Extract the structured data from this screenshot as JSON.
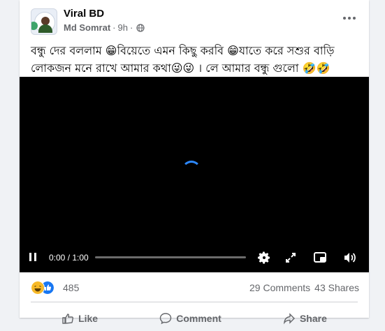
{
  "post": {
    "page_name": "Viral BD",
    "author": "Md Somrat",
    "separator": "·",
    "time": "9h",
    "caption_line1": "বন্ধু দের বললাম 😁বিয়েতে এমন কিছু করবি 😁যাতে করে সশুর বাড়ি",
    "caption_line2": "লোকজন  মনে রাখে  আমার কথা😜😜 । লে আমার বন্ধু গুলো 🤣🤣"
  },
  "video": {
    "time_display": "0:00 / 1:00",
    "progress": 0.0
  },
  "engagement": {
    "reactions_count": "485",
    "comments": "29 Comments",
    "shares": "43 Shares"
  },
  "actions": {
    "like": "Like",
    "comment": "Comment",
    "share": "Share"
  },
  "icons": {
    "globe": "globe-icon",
    "more": "more-icon",
    "pause": "pause-icon",
    "settings": "gear-icon",
    "fullscreen": "expand-icon",
    "pip": "picture-in-picture-icon",
    "volume": "volume-icon",
    "haha": "haha-reaction-icon",
    "like": "like-reaction-icon"
  },
  "colors": {
    "accent": "#2d88ff",
    "like_blue": "#1877f2",
    "haha_yellow": "#f7b928"
  }
}
